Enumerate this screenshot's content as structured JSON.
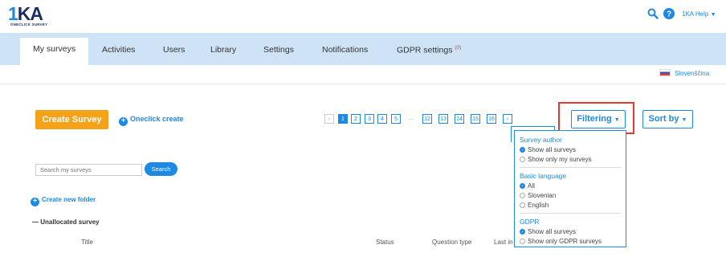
{
  "header": {
    "logo": "1KA",
    "logo_tagline": "ONECLICK SURVEY",
    "help_label": "1KA Help"
  },
  "nav": {
    "tabs": [
      "My surveys",
      "Activities",
      "Users",
      "Library",
      "Settings",
      "Notifications",
      "GDPR settings"
    ],
    "gdpr_badge": "(0)"
  },
  "language": "Slovenščina",
  "actions": {
    "create_survey": "Create Survey",
    "oneclick_create": "Oneclick create",
    "filtering": "Filtering",
    "sort_by": "Sort by"
  },
  "pagination": {
    "pages": [
      "1",
      "2",
      "3",
      "4",
      "5",
      "...",
      "12",
      "13",
      "14",
      "15",
      "16"
    ],
    "current": "1",
    "prev": "‹",
    "next": "›"
  },
  "search": {
    "placeholder": "Search my surveys",
    "button": "Search"
  },
  "folders": {
    "create_new": "Create new folder",
    "unallocated": "Unallocated survey"
  },
  "table": {
    "columns": [
      "Title",
      "Status",
      "Question type",
      "Last in"
    ]
  },
  "filter_dropdown": {
    "groups": [
      {
        "heading": "Survey author",
        "options": [
          "Show all surveys",
          "Show only my surveys"
        ],
        "selected": 0
      },
      {
        "heading": "Basic language",
        "options": [
          "All",
          "Slovenian",
          "English"
        ],
        "selected": 0
      },
      {
        "heading": "GDPR",
        "options": [
          "Show all surveys",
          "Show only GDPR surveys"
        ],
        "selected": 0
      }
    ]
  },
  "colors": {
    "accent": "#1e88e5",
    "create_button": "#f5a21b",
    "nav_bg": "#cfe3f6",
    "highlight": "#e53935"
  }
}
